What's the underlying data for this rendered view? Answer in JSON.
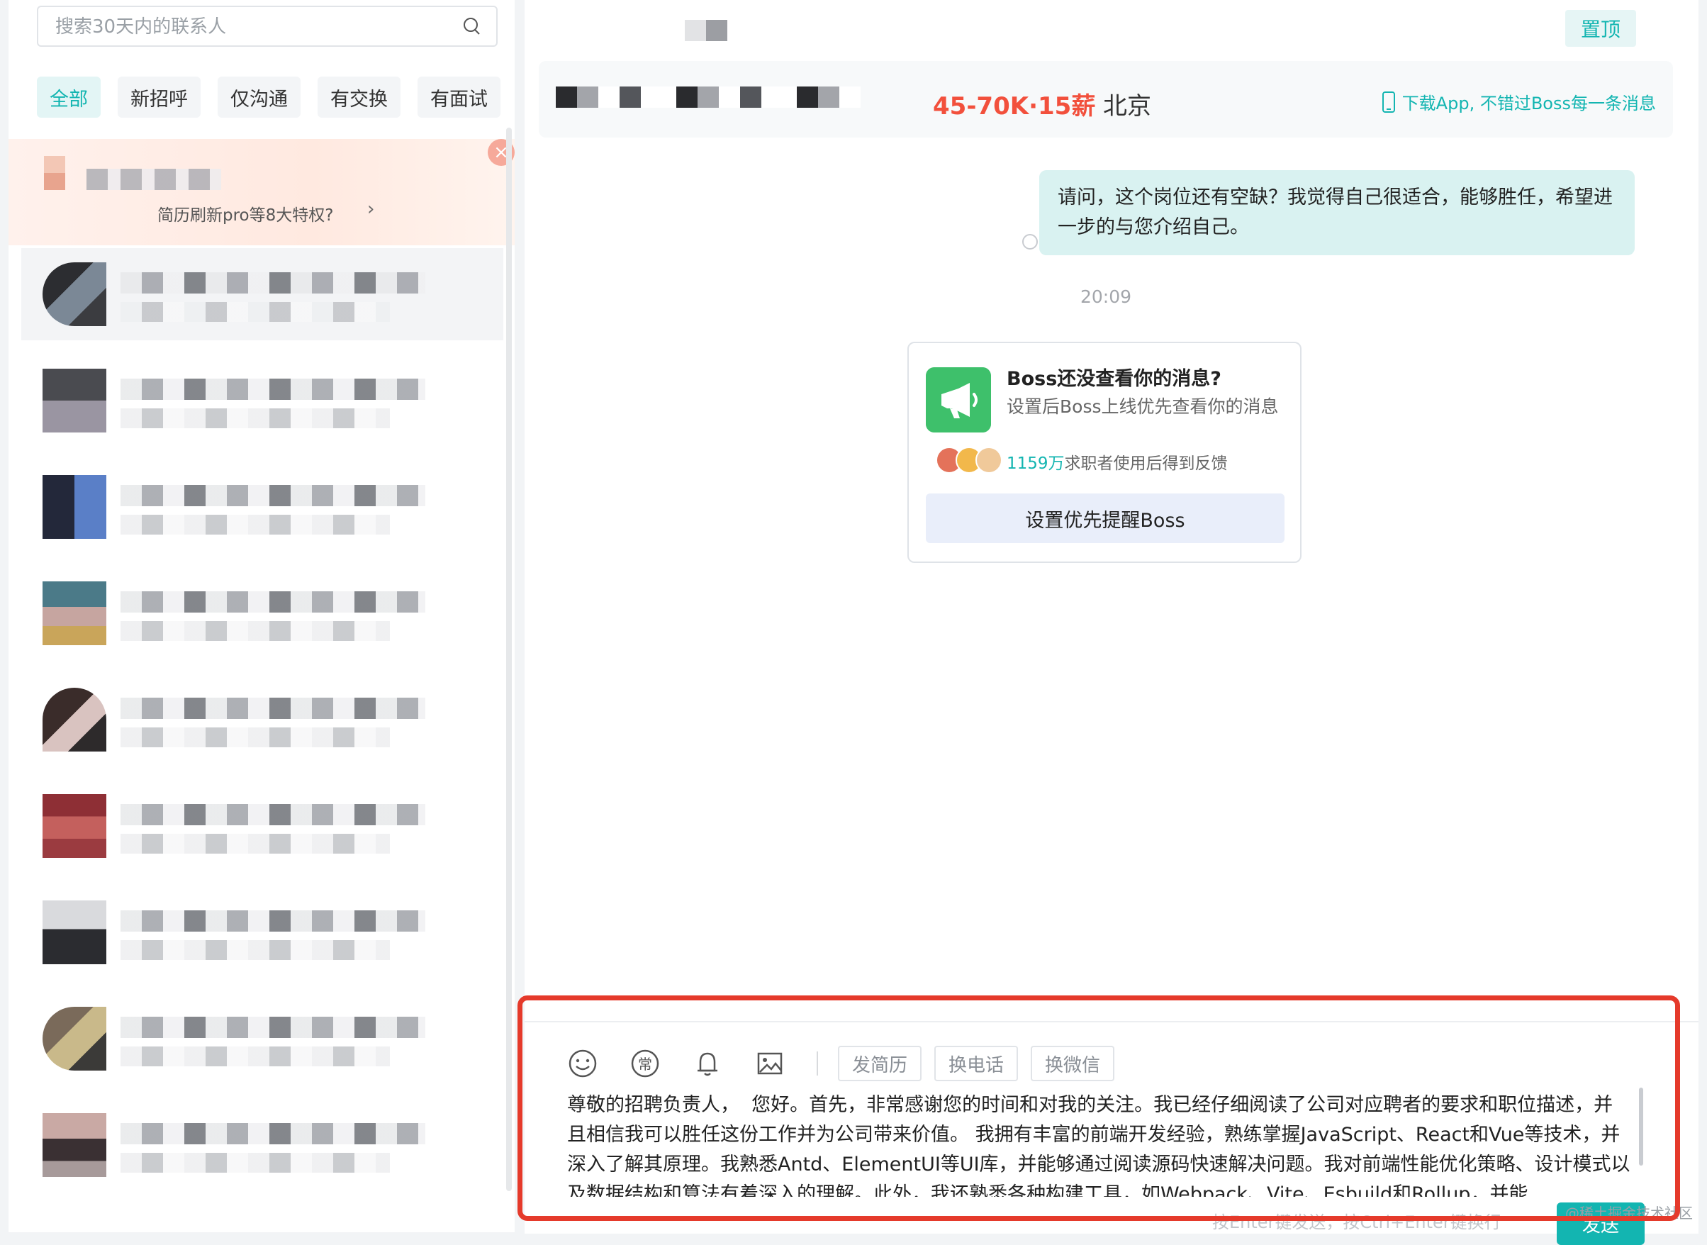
{
  "sidebar": {
    "search_placeholder": "搜索30天内的联系人",
    "tabs": [
      "全部",
      "新招呼",
      "仅沟通",
      "有交换",
      "有面试"
    ],
    "promo": {
      "text": "简历刷新pro等8大特权?",
      "arrow": "›",
      "close": "×"
    }
  },
  "main": {
    "pin_label": "置顶",
    "job": {
      "salary": "45-70K·15薪",
      "city": "北京"
    },
    "download_hint": "下载App, 不错过Boss每一条消息",
    "messages": {
      "sent_text": "请问，这个岗位还有空缺？我觉得自己很适合，能够胜任，希望进一步的与您介绍自己。",
      "timestamp": "20:09"
    },
    "notice": {
      "title": "Boss还没查看你的消息?",
      "desc": "设置后Boss上线优先查看你的消息",
      "stats_highlight": "1159万",
      "stats_rest": "求职者使用后得到反馈",
      "button": "设置优先提醒Boss"
    }
  },
  "composer": {
    "buttons": {
      "resume": "发简历",
      "phone": "换电话",
      "wechat": "换微信"
    },
    "draft": "尊敬的招聘负责人，  您好。首先，非常感谢您的时间和对我的关注。我已经仔细阅读了公司对应聘者的要求和职位描述，并且相信我可以胜任这份工作并为公司带来价值。 我拥有丰富的前端开发经验，熟练掌握JavaScript、React和Vue等技术，并深入了解其原理。我熟悉Antd、ElementUI等UI库，并能够通过阅读源码快速解决问题。我对前端性能优化策略、设计模式以及数据结构和算法有着深入的理解。此外，我还熟悉各种构建工具，如Webpack、Vite、Esbuild和Rollup，并能",
    "send_hint": "按Enter键发送，按Ctrl+Enter键换行",
    "send_label": "发送",
    "watermark": "@稀土掘金技术社区"
  },
  "colors": {
    "accent": "#13b5b1",
    "salary": "#f2503c",
    "highlight": "#e53a2b"
  }
}
